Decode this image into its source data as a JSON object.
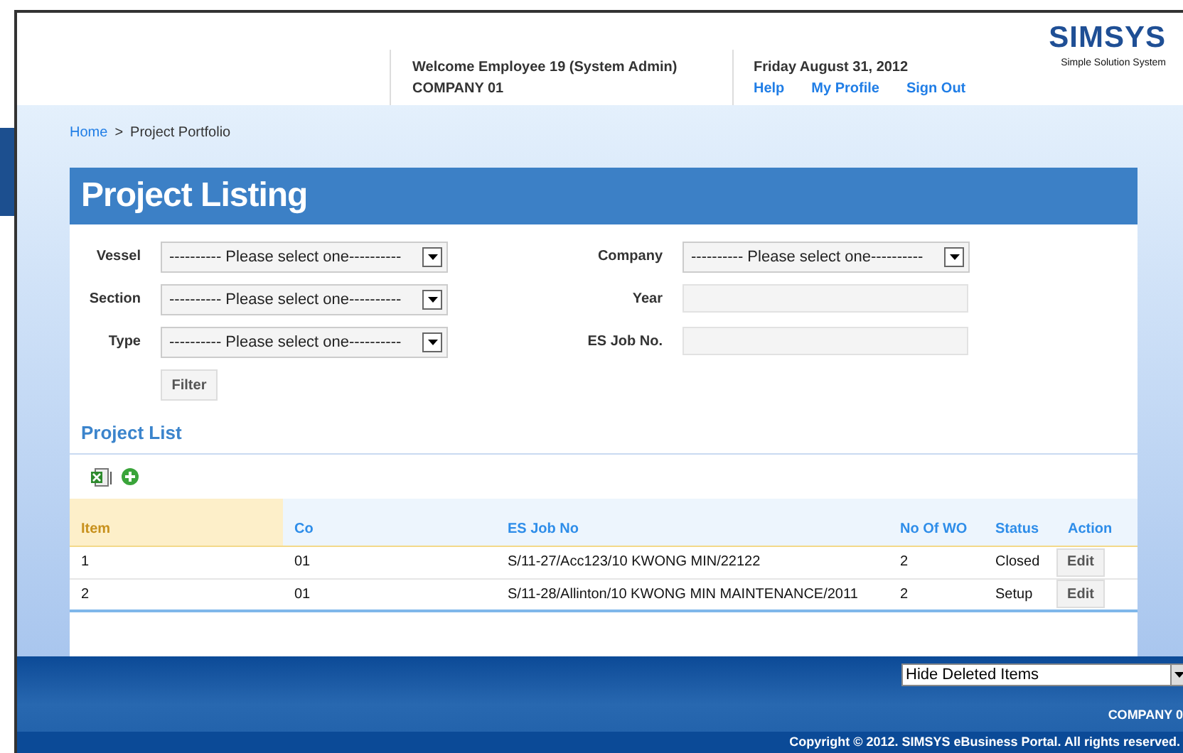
{
  "header": {
    "welcome": "Welcome Employee 19 (System Admin)",
    "company": "COMPANY 01",
    "date": "Friday August 31, 2012",
    "links": [
      "Help",
      "My Profile",
      "Sign Out"
    ],
    "logo": {
      "name": "SIMSYS",
      "tagline": "Simple Solution System"
    }
  },
  "breadcrumb": {
    "home": "Home",
    "separator": ">",
    "current": "Project Portfolio"
  },
  "panel_title": "Project Listing",
  "filters": {
    "left": [
      {
        "label": "Vessel",
        "kind": "select",
        "value": "---------- Please select one----------"
      },
      {
        "label": "Section",
        "kind": "select",
        "value": "---------- Please select one----------"
      },
      {
        "label": "Type",
        "kind": "select",
        "value": "---------- Please select one----------"
      }
    ],
    "right": [
      {
        "label": "Company",
        "kind": "select",
        "value": "---------- Please select one----------"
      },
      {
        "label": "Year",
        "kind": "text"
      },
      {
        "label": "ES Job No.",
        "kind": "text"
      }
    ],
    "button": "Filter"
  },
  "list_title": "Project List",
  "table": {
    "columns": [
      {
        "label": "Item",
        "sorted": true
      },
      {
        "label": "Co",
        "sorted": false
      },
      {
        "label": "ES Job No",
        "sorted": false
      },
      {
        "label": "No Of WO",
        "sorted": false
      },
      {
        "label": "Status",
        "sorted": false
      },
      {
        "label": "Action",
        "sorted": false
      }
    ],
    "rows": [
      {
        "item": "1",
        "co": "01",
        "job": "S/11-27/Acc123/10 KWONG MIN/22122",
        "wo": "2",
        "status": "Closed",
        "action": "Edit"
      },
      {
        "item": "2",
        "co": "01",
        "job": "S/11-28/Allinton/10 KWONG MIN MAINTENANCE/2011",
        "wo": "2",
        "status": "Setup",
        "action": "Edit"
      }
    ]
  },
  "footer": {
    "filter_select": "Hide Deleted Items",
    "company": "COMPANY 0",
    "copyright": "Copyright © 2012. SIMSYS eBusiness Portal. All rights reserved."
  }
}
